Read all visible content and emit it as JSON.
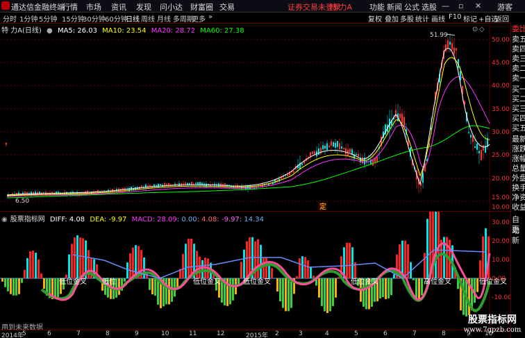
{
  "app": {
    "name": "通达信金融终端",
    "menus": [
      "行情",
      "市场",
      "资讯",
      "发现",
      "问小达",
      "财富圈",
      "交易"
    ],
    "login_status": "证券交易未登录",
    "stock_title": "特 力A",
    "functions": [
      "功能",
      "新闻",
      "公式",
      "选股",
      "游客"
    ]
  },
  "period_bar": {
    "periods": [
      "分时",
      "1分钟",
      "5分钟",
      "15分钟",
      "30分钟",
      "60分钟",
      "日线",
      "周线",
      "月线",
      "多周期",
      "更多"
    ],
    "active": "日线",
    "tools": [
      "复权",
      "叠加",
      "多股",
      "统计",
      "画线",
      "F10",
      "标记",
      "+自选",
      "返回"
    ]
  },
  "price_chart": {
    "header_name": "特 力A",
    "header_period": "(日线)",
    "ma5": "MA5: 26.03",
    "ma10": "MA10: 23.54",
    "ma20": "MA20: 28.72",
    "ma60": "MA60: 27.38",
    "high_label": "51.99",
    "low_label": "6.50",
    "marker": "定",
    "price_ticks": [
      "50.00",
      "45.00",
      "40.00",
      "35.00",
      "30.00",
      "25.00",
      "20.00",
      "15.00",
      "10.00"
    ]
  },
  "indicator": {
    "name": "股票指标网",
    "diff": "DIFF: 4.08",
    "dea": "DEA: -9.97",
    "macd": "MACD: 28.09",
    "v1": ": 0.00",
    "v2": ": 4.08",
    "v3": ": -9.97",
    "v4": ": 14.34",
    "ticks": [
      "30.00",
      "20.00",
      "10.00",
      "0.00",
      "-10.00"
    ],
    "labels": [
      "低位金叉",
      "低位",
      "低位金叉",
      "低位金叉",
      "低位金叉",
      "高位金叉",
      "低位金叉"
    ]
  },
  "date_axis": [
    "2014年",
    "5",
    "6",
    "7",
    "8",
    "9",
    "10",
    "11",
    "12",
    "2015年",
    "2",
    "3",
    "4",
    "5",
    "6",
    "7",
    "8",
    "9",
    "10"
  ],
  "footer": {
    "no_future": "用到未来数据"
  },
  "right_sidebar": {
    "items": [
      "委比",
      "卖五",
      "卖四",
      "卖三",
      "卖二",
      "卖一",
      "买一",
      "买二",
      "买三",
      "买四",
      "买五",
      "最新",
      "涨跌",
      "涨幅",
      "总量",
      "外盘",
      "换手",
      "净资",
      "收益"
    ],
    "bottom": [
      "自动",
      "更新"
    ]
  },
  "watermark": {
    "line1": "股票指标网",
    "line2": "www.7gpzb.com"
  },
  "colors": {
    "up": "#ff3333",
    "down": "#00e5e5",
    "ma5": "#ffffff",
    "ma10": "#ffff00",
    "ma20": "#ff33ff",
    "ma60": "#00ff00",
    "grid": "#5a0000"
  }
}
